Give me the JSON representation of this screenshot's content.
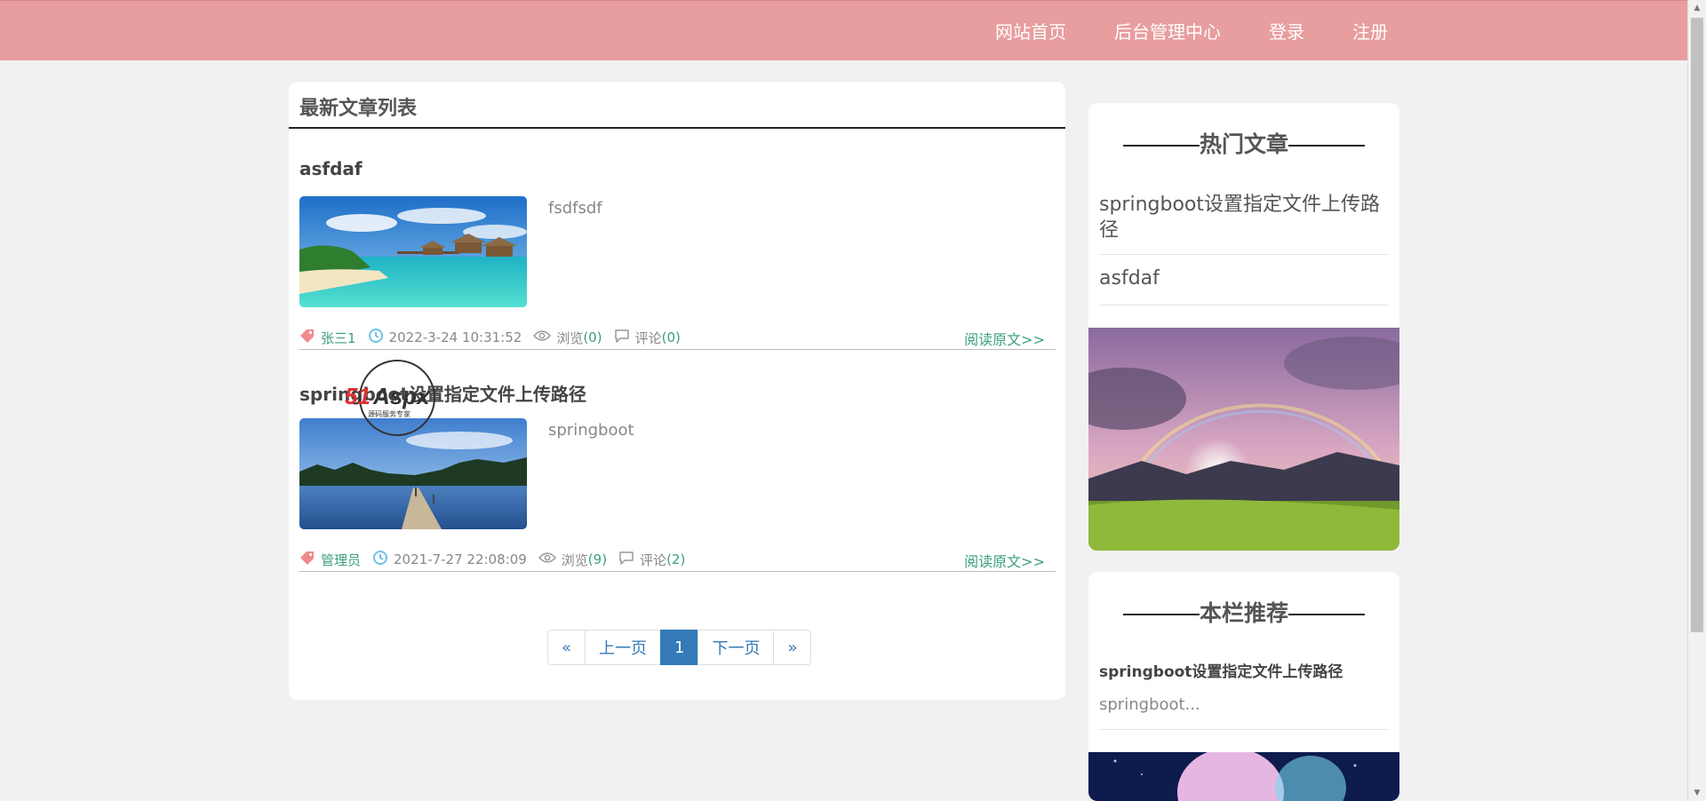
{
  "nav": {
    "items": [
      "网站首页",
      "后台管理中心",
      "登录",
      "注册"
    ]
  },
  "main": {
    "title": "最新文章列表",
    "articles": [
      {
        "title": "asfdaf",
        "summary": "fsdfsdf",
        "author": "张三1",
        "date": "2022-3-24 10:31:52",
        "views_label": "浏览",
        "views": "(0)",
        "comments_label": "评论",
        "comments": "(0)",
        "read_more": "阅读原文>>",
        "image": "tropical-beach-image"
      },
      {
        "title": "springboot设置指定文件上传路径",
        "summary": "springboot",
        "author": "管理员",
        "date": "2021-7-27 22:08:09",
        "views_label": "浏览",
        "views": "(9)",
        "comments_label": "评论",
        "comments": "(2)",
        "read_more": "阅读原文>>",
        "image": "lake-pier-image"
      }
    ],
    "pager": {
      "first": "«",
      "prev": "上一页",
      "current": "1",
      "next": "下一页",
      "last": "»"
    }
  },
  "sidebar": {
    "hot": {
      "title": "热门文章",
      "items": [
        "springboot设置指定文件上传路径",
        "asfdaf"
      ]
    },
    "recommend": {
      "title": "本栏推荐",
      "item_title": "springboot设置指定文件上传路径",
      "item_summary": "springboot..."
    }
  },
  "watermark": {
    "brand": "51Aspx",
    "tagline": "源码服务专家"
  },
  "colors": {
    "topbar": "#e89d9e",
    "accent_green": "#3a9f7a",
    "pager_blue": "#337ab7"
  }
}
